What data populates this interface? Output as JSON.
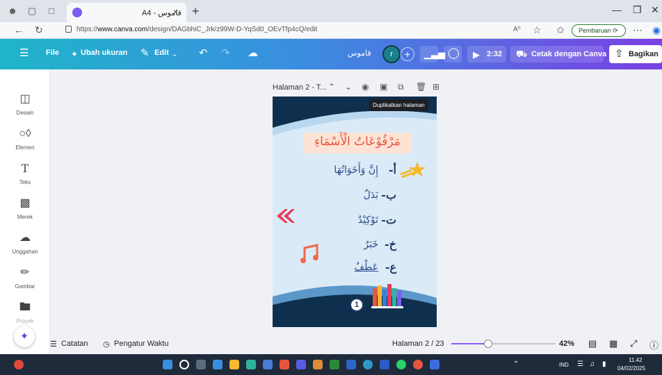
{
  "browser": {
    "tab_title": "A4 - قاموس",
    "close_glyph": "×",
    "new_tab_glyph": "+",
    "url_prefix": "https://",
    "url_host": "www.canva.com",
    "url_path": "/design/DAGbhiC_Jrk/z99W-D-YqSd0_OEvTfp4cQ/edit",
    "update_label": "Pembaruan"
  },
  "topbar": {
    "file": "File",
    "resize": "Ubah ukuran",
    "edit": "Edit",
    "doc_title": "قاموس",
    "avatar_initial": "r",
    "play_time": "2:32",
    "print": "Cetak dengan Canva",
    "share": "Bagikan"
  },
  "sidebar": {
    "items": [
      {
        "label": "Desain",
        "icon": "layout-icon"
      },
      {
        "label": "Elemen",
        "icon": "shapes-icon"
      },
      {
        "label": "Teks",
        "icon": "text-icon"
      },
      {
        "label": "Merek",
        "icon": "brand-icon"
      },
      {
        "label": "Unggahan",
        "icon": "upload-icon"
      },
      {
        "label": "Gambar",
        "icon": "draw-icon"
      },
      {
        "label": "Proyek",
        "icon": "folder-icon"
      }
    ]
  },
  "page_toolbar": {
    "title": "Halaman 2 - T...",
    "tooltip": "Duplikatkan halaman"
  },
  "design": {
    "heading": "مَرْفُوْعَاتُ الْأَسْمَاءِ",
    "items": [
      {
        "letter": "أ-",
        "text": "إِنَّ وَأَخَوَاتُهَا"
      },
      {
        "letter": "ب-",
        "text": "بَدَلٌ"
      },
      {
        "letter": "ت-",
        "text": "تَوْكِيْدٌ"
      },
      {
        "letter": "خ-",
        "text": "خَبَرٌ"
      },
      {
        "letter": "ع-",
        "text": "عَطْفٌ"
      }
    ],
    "page_number": "1",
    "colors": {
      "heading": "#e8553f",
      "letter": "#1f3a66",
      "text": "#2b4a8a"
    }
  },
  "bottombar": {
    "notes": "Catatan",
    "timer": "Pengatur Waktu",
    "page_indicator": "Halaman 2 / 23",
    "zoom_fraction": 0.35,
    "zoom": "42%"
  },
  "taskbar": {
    "lang": "IND",
    "time": "11.42",
    "date": "04/02/2025"
  }
}
